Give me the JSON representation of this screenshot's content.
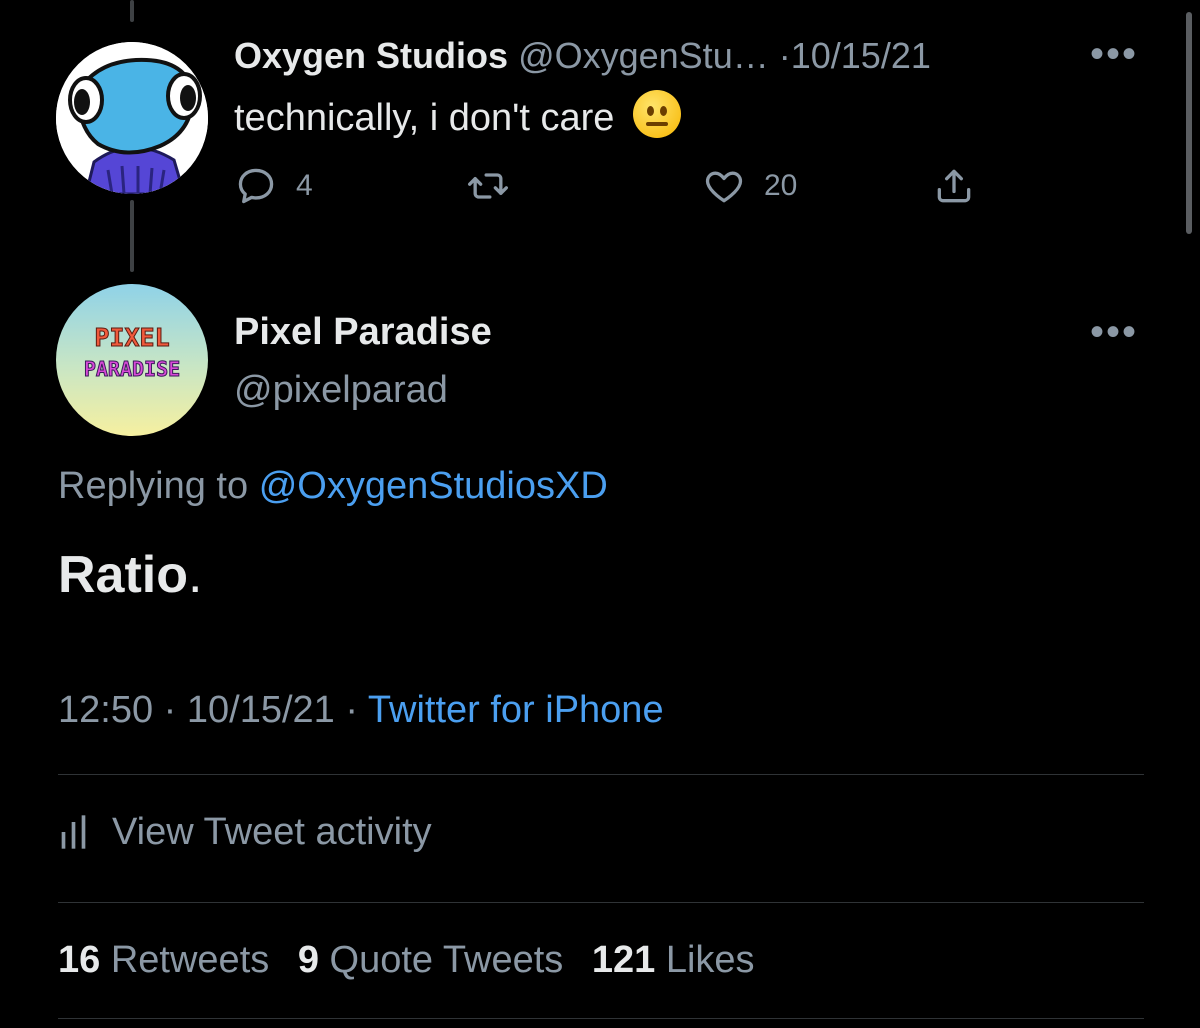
{
  "parent_tweet": {
    "author_name": "Oxygen Studios",
    "author_handle": "@OxygenStu…",
    "separator": "·",
    "date": "10/15/21",
    "more_label": "•••",
    "text": "technically, i don't care",
    "emoji": "neutral-face-emoji",
    "reply_count": "4",
    "retweet_count": "",
    "like_count": "20"
  },
  "main_tweet": {
    "author_name": "Pixel Paradise",
    "author_handle": "@pixelparad",
    "more_label": "•••",
    "replying_prefix": "Replying to",
    "replying_to": "@OxygenStudiosXD",
    "text": "Ratio",
    "text_punct": ".",
    "time": "12:50",
    "separator": "·",
    "date": "10/15/21",
    "source": "Twitter for iPhone",
    "activity_label": "View Tweet activity",
    "stats": {
      "retweets_count": "16",
      "retweets_label": "Retweets",
      "quotes_count": "9",
      "quotes_label": "Quote Tweets",
      "likes_count": "121",
      "likes_label": "Likes"
    }
  },
  "avatar_text": {
    "pixel_line1": "PIXEL",
    "pixel_line2": "PARADISE"
  },
  "colors": {
    "background": "#000000",
    "text": "#e7e9ea",
    "muted": "#8b98a5",
    "link": "#4b9ff0",
    "divider": "#2f3336"
  }
}
